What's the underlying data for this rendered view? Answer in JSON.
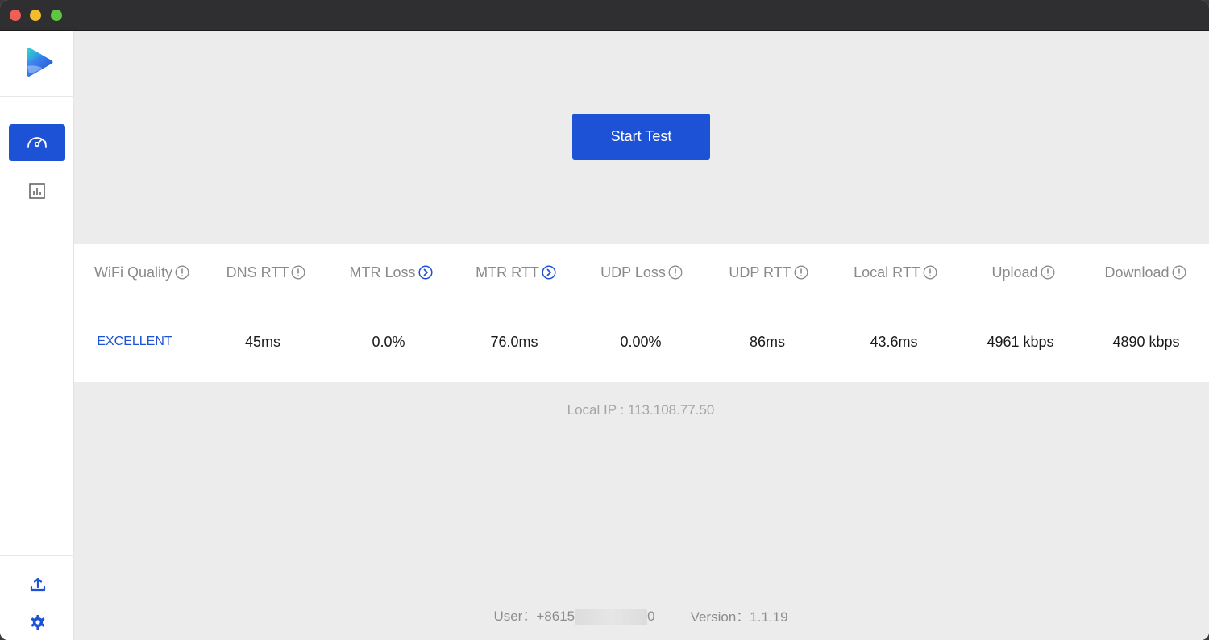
{
  "icons": {
    "logo": "app-logo",
    "nav_speed": "speedometer-icon",
    "nav_stats": "bar-chart-icon",
    "upload": "upload-icon",
    "settings": "gear-icon",
    "info": "info-icon",
    "detail": "chevron-right-circle-icon"
  },
  "colors": {
    "accent": "#1d52d6",
    "background": "#ececec",
    "panel": "#ffffff"
  },
  "main": {
    "start_button_label": "Start Test"
  },
  "results": {
    "columns": [
      {
        "label": "WiFi Quality",
        "icon": "info",
        "value": "EXCELLENT"
      },
      {
        "label": "DNS RTT",
        "icon": "info",
        "value": "45ms"
      },
      {
        "label": "MTR Loss",
        "icon": "detail",
        "value": "0.0%"
      },
      {
        "label": "MTR RTT",
        "icon": "detail",
        "value": "76.0ms"
      },
      {
        "label": "UDP Loss",
        "icon": "info",
        "value": "0.00%"
      },
      {
        "label": "UDP RTT",
        "icon": "info",
        "value": "86ms"
      },
      {
        "label": "Local RTT",
        "icon": "info",
        "value": "43.6ms"
      },
      {
        "label": "Upload",
        "icon": "info",
        "value": "4961 kbps"
      },
      {
        "label": "Download",
        "icon": "info",
        "value": "4890 kbps"
      }
    ]
  },
  "status": {
    "local_ip": "Local IP : 113.108.77.50"
  },
  "footer": {
    "user_label": "User：",
    "user_prefix": "+8615",
    "user_suffix": "0",
    "version_label": "Version：",
    "version_value": "1.1.19"
  }
}
